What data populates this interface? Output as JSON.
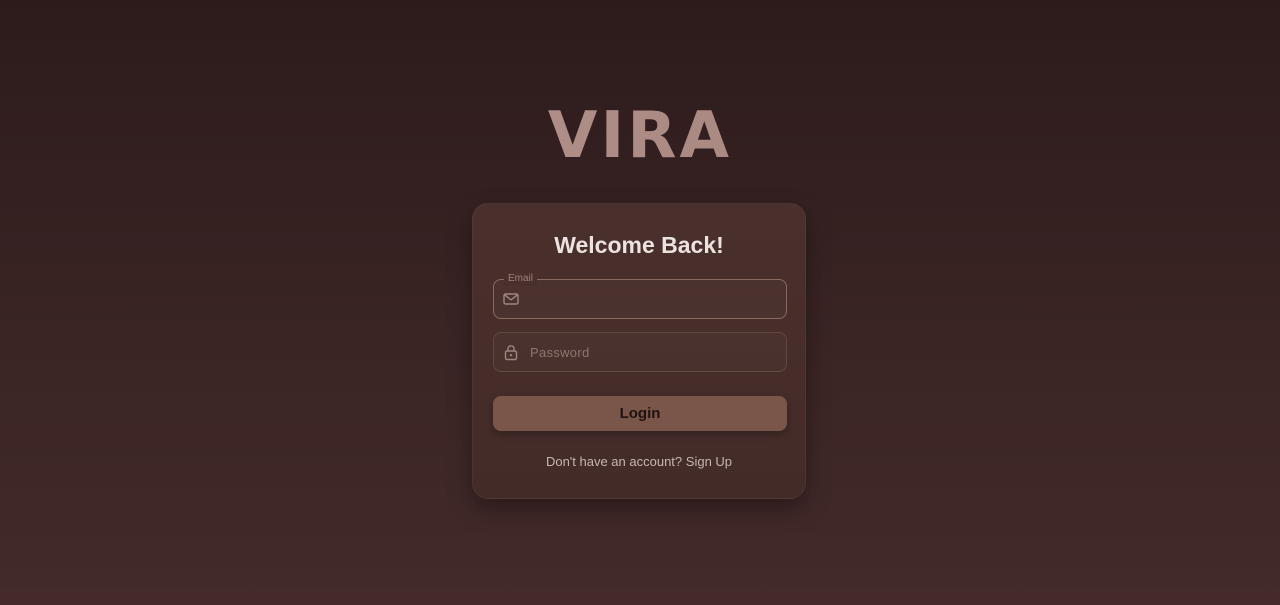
{
  "brand": {
    "logo_text": "VIRA"
  },
  "login_card": {
    "title": "Welcome Back!",
    "email": {
      "label": "Email",
      "value": "",
      "icon": "mail-icon"
    },
    "password": {
      "placeholder": "Password",
      "value": "",
      "icon": "lock-icon"
    },
    "login_button": "Login",
    "signup_prompt": "Don't have an account?",
    "signup_link": "Sign Up"
  },
  "colors": {
    "background_top": "#2d1b1b",
    "background_bottom": "#442a2a",
    "card": "#4a302d",
    "accent_button": "#7a564a",
    "logo": "#b5928a"
  }
}
